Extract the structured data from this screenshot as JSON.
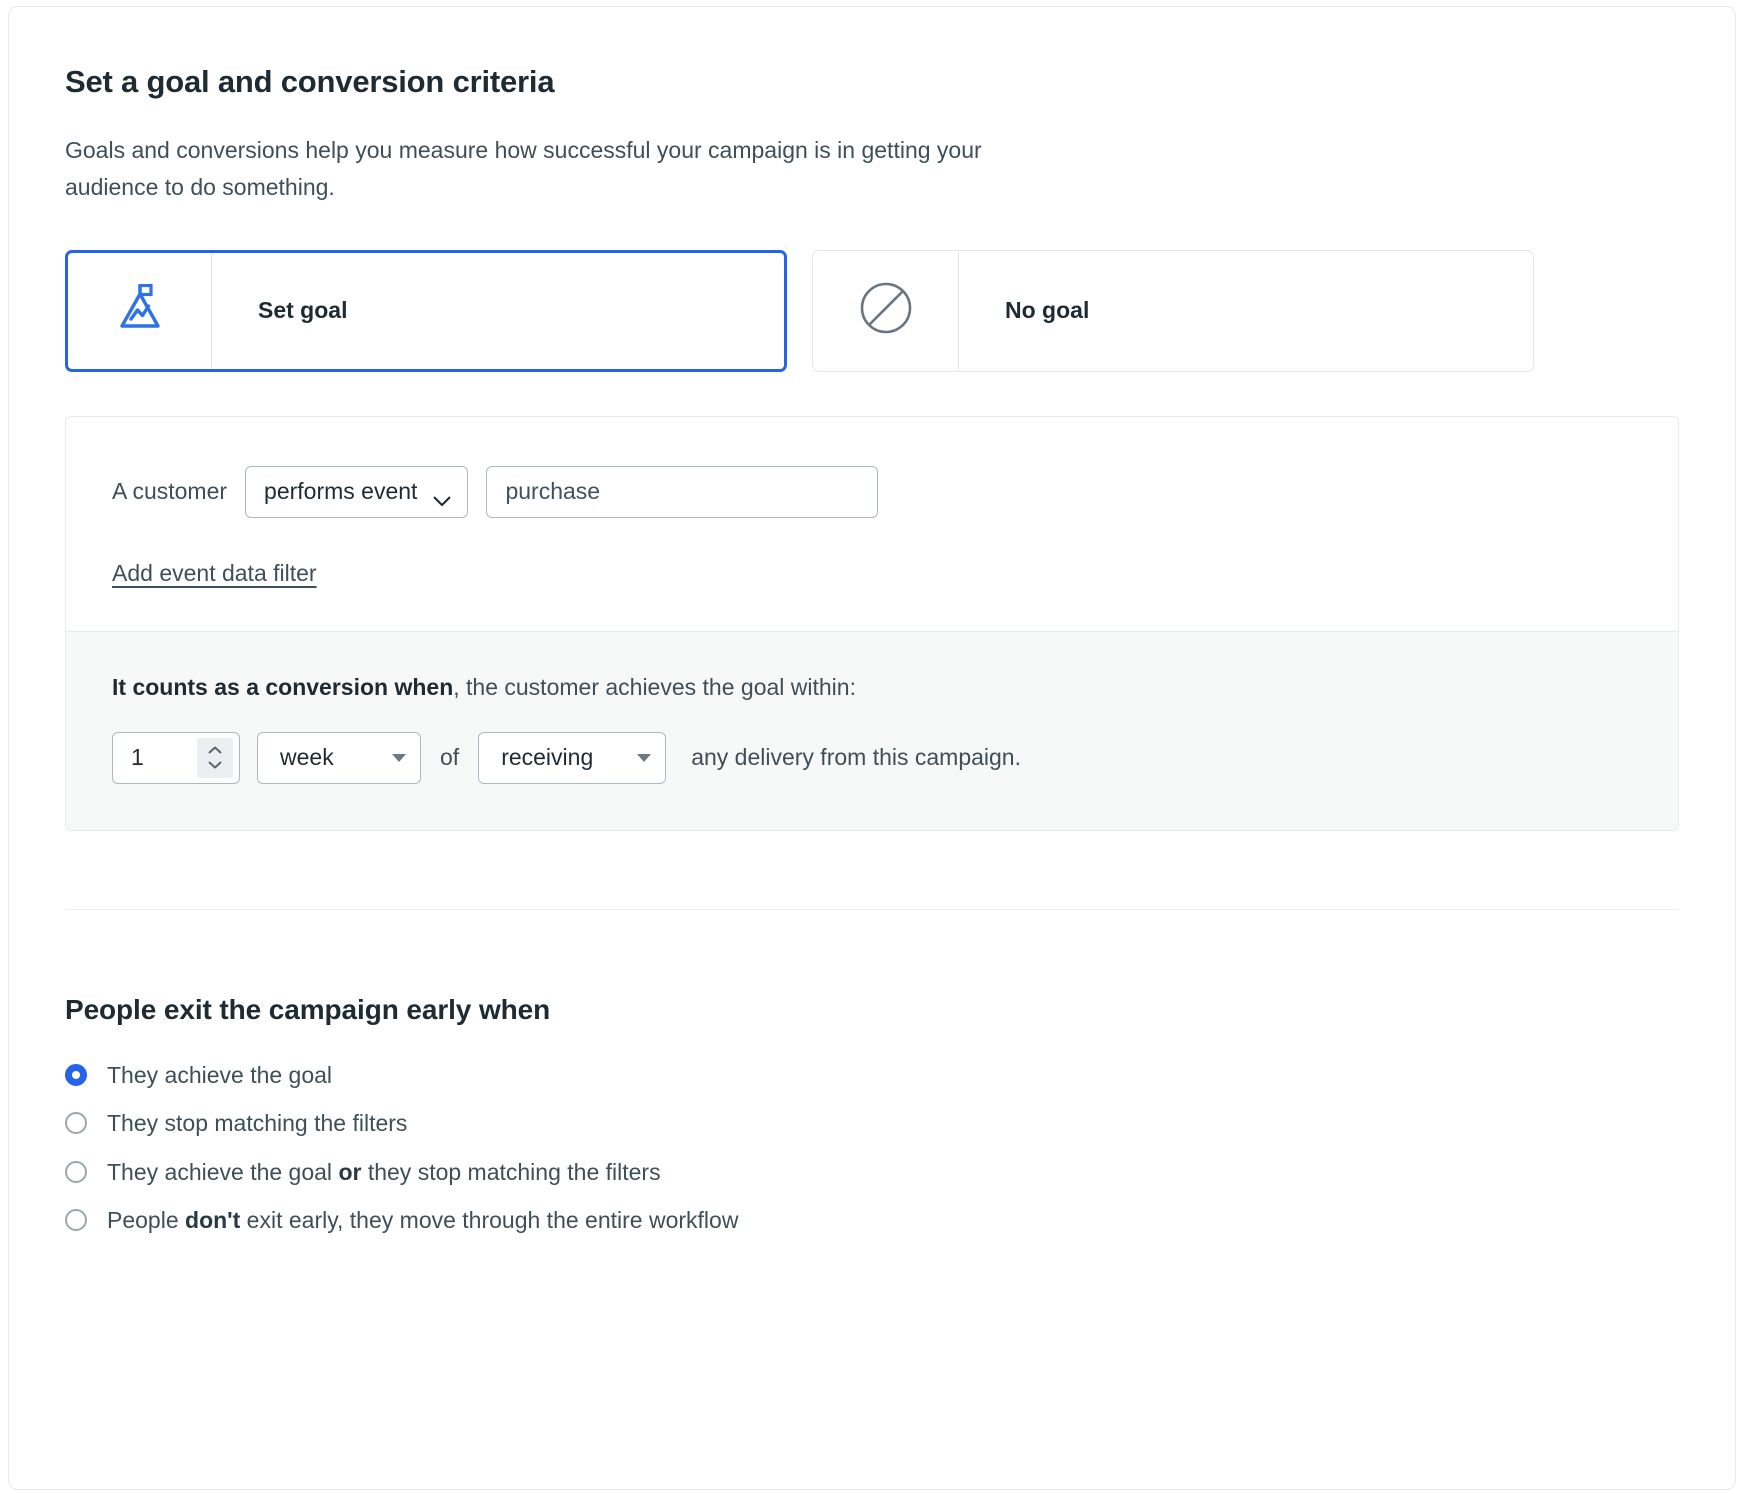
{
  "goal_section": {
    "title": "Set a goal and conversion criteria",
    "description": "Goals and conversions help you measure how successful your campaign is in getting your audience to do something.",
    "choices": [
      {
        "label": "Set goal",
        "icon": "mountain-flag-icon",
        "selected": true
      },
      {
        "label": "No goal",
        "icon": "prohibition-icon",
        "selected": false
      }
    ],
    "builder": {
      "condition_prefix": "A customer",
      "event_type_select": {
        "value": "performs event",
        "icon": "chevron-down-icon"
      },
      "event_name_input": {
        "value": "purchase",
        "placeholder": "purchase"
      },
      "add_filter_link": "Add event data filter",
      "conversion": {
        "lead_bold": "It counts as a conversion when",
        "lead_rest": ", the customer achieves the goal within:",
        "amount": "1",
        "unit_select": {
          "value": "week",
          "icon": "caret-down-icon"
        },
        "joiner": "of",
        "trigger_select": {
          "value": "receiving",
          "icon": "caret-down-icon"
        },
        "tail": "any delivery from this campaign."
      }
    }
  },
  "exit_section": {
    "title": "People exit the campaign early when",
    "options": [
      {
        "text": "They achieve the goal",
        "selected": true
      },
      {
        "text": "They stop matching the filters",
        "selected": false
      },
      {
        "text_before": "They achieve the goal ",
        "text_bold": "or",
        "text_after": " they stop matching the filters",
        "selected": false
      },
      {
        "text_before": "People ",
        "text_bold": "don't",
        "text_after": " exit early, they move through the entire workflow",
        "selected": false
      }
    ]
  },
  "colors": {
    "accent": "#2563eb",
    "text_primary": "#1f2b33",
    "text_secondary": "#3f4f58",
    "border": "#aeb9bf",
    "panel_bg": "#f7f9f9"
  }
}
